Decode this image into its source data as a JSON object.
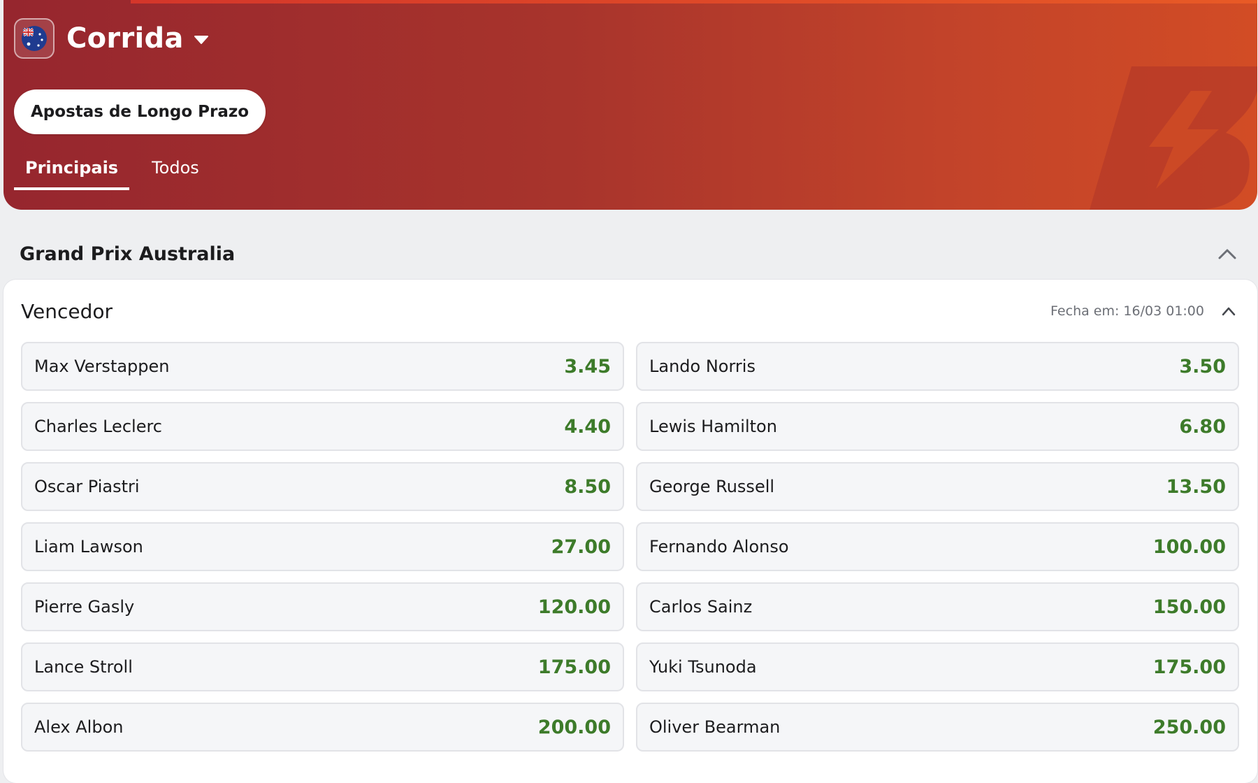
{
  "header": {
    "title": "Corrida",
    "pill_label": "Apostas de Longo Prazo",
    "flag_icon": "australia-flag-icon",
    "gradient_colors": [
      "#96262e",
      "#d24c25"
    ],
    "tabs": [
      {
        "label": "Principais",
        "active": true
      },
      {
        "label": "Todos",
        "active": false
      }
    ]
  },
  "section": {
    "title": "Grand Prix Australia",
    "chevron_icon": "chevron-up-icon"
  },
  "market": {
    "name": "Vencedor",
    "closes": "Fecha em: 16/03 01:00",
    "odds_color": "#3d7b2a",
    "selections": [
      {
        "name": "Max Verstappen",
        "odds": "3.45"
      },
      {
        "name": "Lando Norris",
        "odds": "3.50"
      },
      {
        "name": "Charles Leclerc",
        "odds": "4.40"
      },
      {
        "name": "Lewis Hamilton",
        "odds": "6.80"
      },
      {
        "name": "Oscar Piastri",
        "odds": "8.50"
      },
      {
        "name": "George Russell",
        "odds": "13.50"
      },
      {
        "name": "Liam Lawson",
        "odds": "27.00"
      },
      {
        "name": "Fernando Alonso",
        "odds": "100.00"
      },
      {
        "name": "Pierre Gasly",
        "odds": "120.00"
      },
      {
        "name": "Carlos Sainz",
        "odds": "150.00"
      },
      {
        "name": "Lance Stroll",
        "odds": "175.00"
      },
      {
        "name": "Yuki Tsunoda",
        "odds": "175.00"
      },
      {
        "name": "Alex Albon",
        "odds": "200.00"
      },
      {
        "name": "Oliver Bearman",
        "odds": "250.00"
      }
    ]
  }
}
